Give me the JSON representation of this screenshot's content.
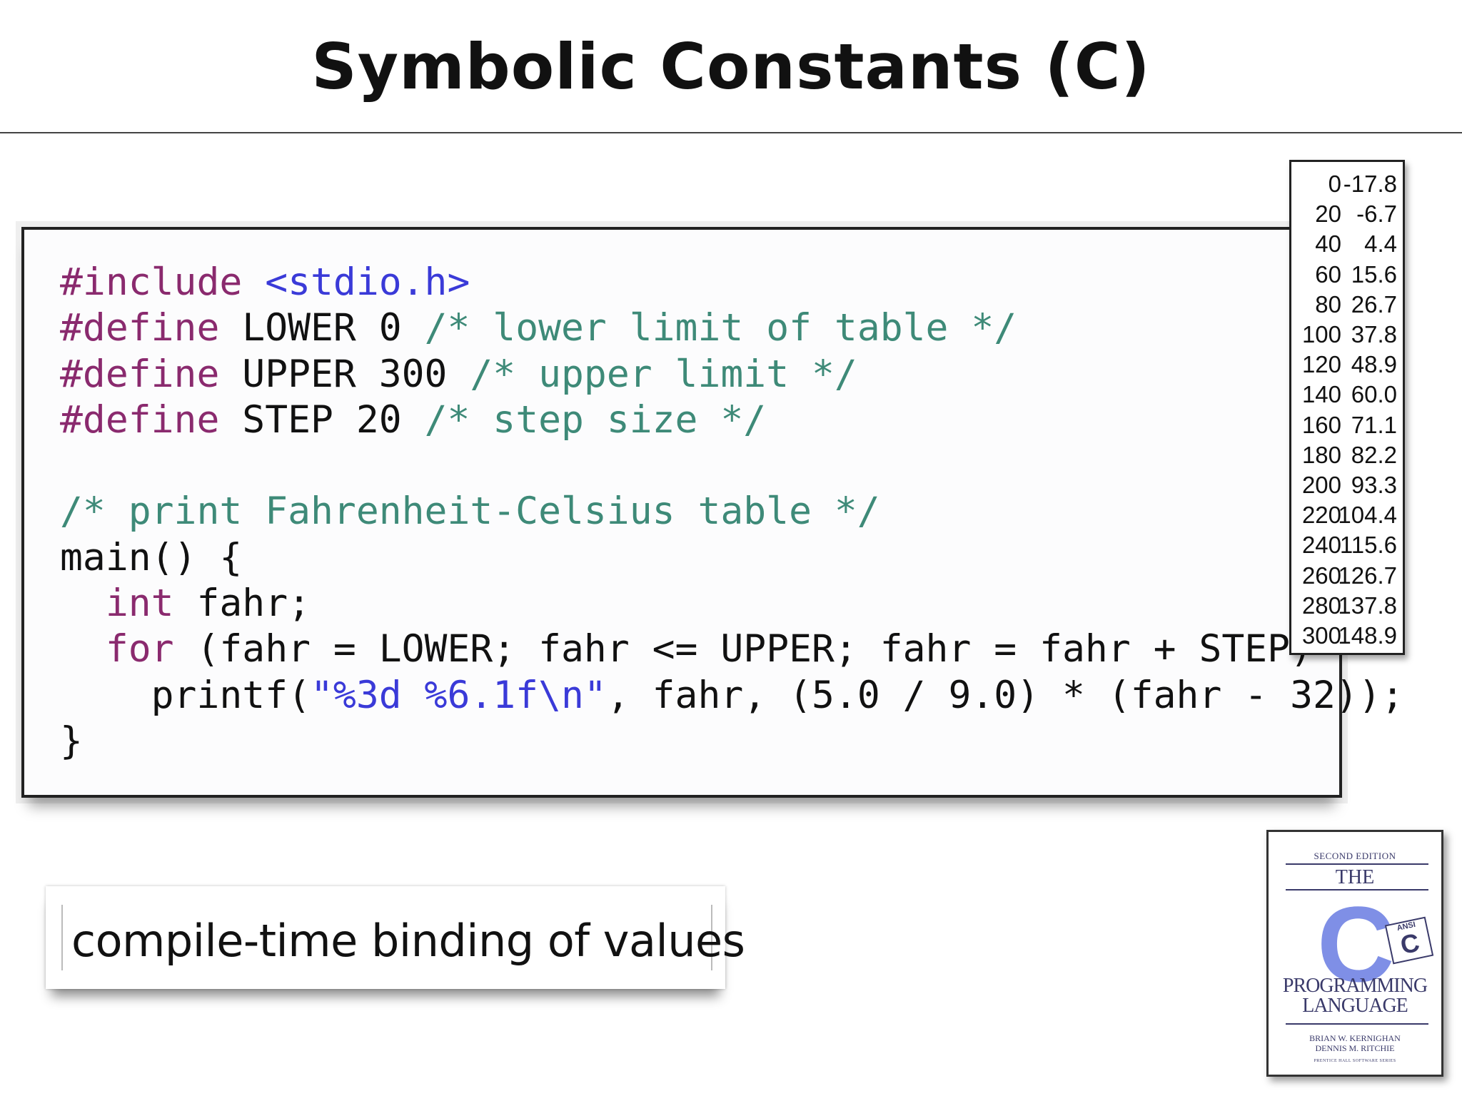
{
  "slide": {
    "title": "Symbolic Constants (C)"
  },
  "code": {
    "lines": [
      [
        {
          "t": "#include ",
          "k": "kw"
        },
        {
          "t": "<stdio.h>",
          "k": "hdr"
        }
      ],
      [
        {
          "t": "#define ",
          "k": "kw"
        },
        {
          "t": "LOWER 0 ",
          "k": ""
        },
        {
          "t": "/* lower limit of table */",
          "k": "cmt"
        }
      ],
      [
        {
          "t": "#define ",
          "k": "kw"
        },
        {
          "t": "UPPER 300 ",
          "k": ""
        },
        {
          "t": "/* upper limit */",
          "k": "cmt"
        }
      ],
      [
        {
          "t": "#define ",
          "k": "kw"
        },
        {
          "t": "STEP 20 ",
          "k": ""
        },
        {
          "t": "/* step size */",
          "k": "cmt"
        }
      ],
      [
        {
          "t": "",
          "k": ""
        }
      ],
      [
        {
          "t": "/* print Fahrenheit-Celsius table */",
          "k": "cmt"
        }
      ],
      [
        {
          "t": "main() {",
          "k": ""
        }
      ],
      [
        {
          "t": "  ",
          "k": ""
        },
        {
          "t": "int",
          "k": "ctl"
        },
        {
          "t": " fahr;",
          "k": ""
        }
      ],
      [
        {
          "t": "  ",
          "k": ""
        },
        {
          "t": "for",
          "k": "ctl"
        },
        {
          "t": " (fahr = LOWER; fahr <= UPPER; fahr = fahr + STEP)",
          "k": ""
        }
      ],
      [
        {
          "t": "    printf(",
          "k": ""
        },
        {
          "t": "\"%3d %6.1f\\n\"",
          "k": "str"
        },
        {
          "t": ", fahr, (5.0 / 9.0) * (fahr - 32));",
          "k": ""
        }
      ],
      [
        {
          "t": "}",
          "k": ""
        }
      ]
    ]
  },
  "output_table": {
    "rows": [
      {
        "f": "0",
        "c": "-17.8"
      },
      {
        "f": "20",
        "c": "-6.7"
      },
      {
        "f": "40",
        "c": "4.4"
      },
      {
        "f": "60",
        "c": "15.6"
      },
      {
        "f": "80",
        "c": "26.7"
      },
      {
        "f": "100",
        "c": "37.8"
      },
      {
        "f": "120",
        "c": "48.9"
      },
      {
        "f": "140",
        "c": "60.0"
      },
      {
        "f": "160",
        "c": "71.1"
      },
      {
        "f": "180",
        "c": "82.2"
      },
      {
        "f": "200",
        "c": "93.3"
      },
      {
        "f": "220",
        "c": "104.4"
      },
      {
        "f": "240",
        "c": "115.6"
      },
      {
        "f": "260",
        "c": "126.7"
      },
      {
        "f": "280",
        "c": "137.8"
      },
      {
        "f": "300",
        "c": "148.9"
      }
    ]
  },
  "caption": {
    "text": "compile-time binding of values"
  },
  "book": {
    "edition": "SECOND EDITION",
    "the": "THE",
    "big_letter": "C",
    "ansi_label": "ANSI",
    "ansi_letter": "C",
    "title_line1": "PROGRAMMING",
    "title_line2": "LANGUAGE",
    "author1": "BRIAN W. KERNIGHAN",
    "author2": "DENNIS M. RITCHIE",
    "publisher": "PRENTICE HALL SOFTWARE SERIES",
    "accent_color": "#7f8fe6"
  }
}
